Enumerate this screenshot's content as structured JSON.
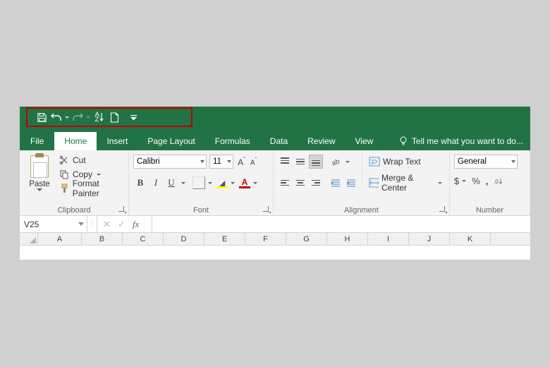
{
  "qat": {
    "items": [
      "save",
      "undo",
      "redo",
      "sort",
      "new",
      "customize"
    ]
  },
  "tabs": {
    "file": "File",
    "home": "Home",
    "insert": "Insert",
    "page_layout": "Page Layout",
    "formulas": "Formulas",
    "data": "Data",
    "review": "Review",
    "view": "View",
    "tell_me": "Tell me what you want to do..."
  },
  "ribbon": {
    "clipboard": {
      "label": "Clipboard",
      "paste": "Paste",
      "cut": "Cut",
      "copy": "Copy",
      "format_painter": "Format Painter"
    },
    "font": {
      "label": "Font",
      "name": "Calibri",
      "size": "11",
      "bold": "B",
      "italic": "I",
      "underline": "U",
      "grow": "A",
      "shrink": "A",
      "font_color_letter": "A"
    },
    "alignment": {
      "label": "Alignment",
      "wrap": "Wrap Text",
      "merge": "Merge & Center"
    },
    "number": {
      "label": "Number",
      "format": "General",
      "currency": "$",
      "percent": "%",
      "comma": ","
    }
  },
  "formula_bar": {
    "cell_ref": "V25",
    "fx": "fx",
    "value": ""
  },
  "columns": [
    "A",
    "B",
    "C",
    "D",
    "E",
    "F",
    "G",
    "H",
    "I",
    "J",
    "K"
  ],
  "colors": {
    "excel_green": "#217346",
    "highlight_red": "#c00000",
    "fill_swatch": "#ffff00",
    "font_color": "#c00000"
  }
}
